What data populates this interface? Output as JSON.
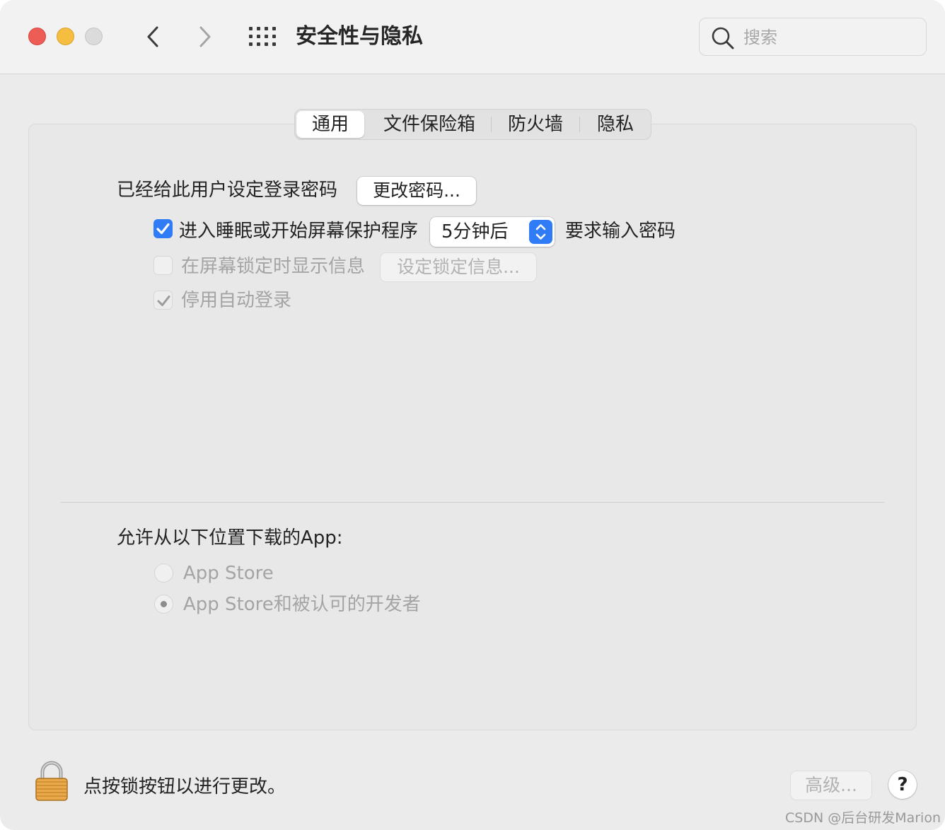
{
  "window": {
    "title": "安全性与隐私",
    "search_placeholder": "搜索"
  },
  "tabs": [
    {
      "label": "通用",
      "active": true
    },
    {
      "label": "文件保险箱",
      "active": false
    },
    {
      "label": "防火墙",
      "active": false
    },
    {
      "label": "隐私",
      "active": false
    }
  ],
  "general": {
    "password_set_label": "已经给此用户设定登录密码",
    "change_password_button": "更改密码...",
    "require_password": {
      "checked": true,
      "prefix": "进入睡眠或开始屏幕保护程序",
      "delay_value": "5分钟后",
      "suffix": "要求输入密码"
    },
    "show_message": {
      "checked": false,
      "label": "在屏幕锁定时显示信息",
      "button": "设定锁定信息..."
    },
    "disable_auto_login": {
      "checked": true,
      "label": "停用自动登录"
    }
  },
  "downloads": {
    "title": "允许从以下位置下载的App:",
    "options": [
      {
        "label": "App Store",
        "selected": false
      },
      {
        "label": "App Store和被认可的开发者",
        "selected": true
      }
    ]
  },
  "footer": {
    "lock_text": "点按锁按钮以进行更改。",
    "advanced_button": "高级...",
    "help_label": "?"
  },
  "watermark": "CSDN @后台研发Marion",
  "colors": {
    "accent": "#2f7cf6",
    "close": "#ee5c56",
    "minimize": "#f5be40",
    "zoom_disabled": "#dcdbdc"
  }
}
